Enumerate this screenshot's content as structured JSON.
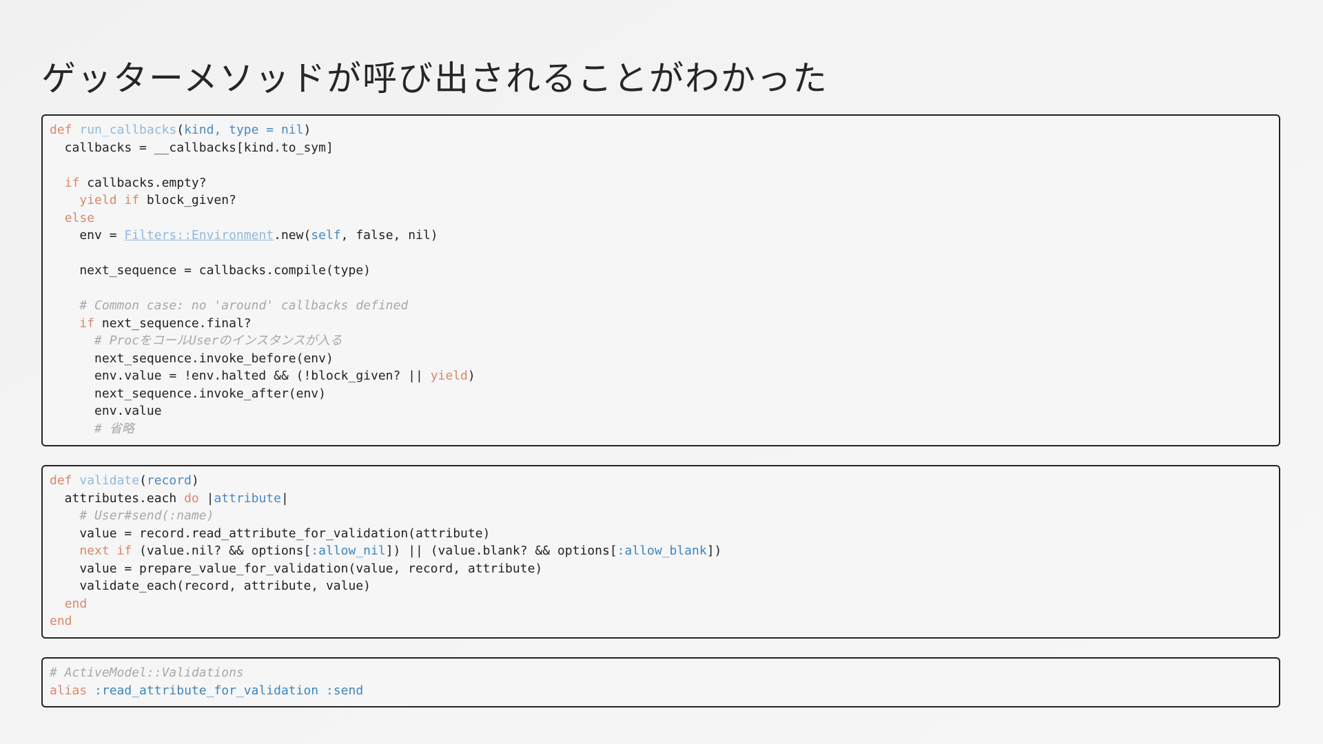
{
  "slide": {
    "title": "ゲッターメソッドが呼び出されることがわかった"
  },
  "colors": {
    "keyword": "#d9876a",
    "function_name": "#8fb9de",
    "parameter": "#4a88c0",
    "symbol": "#3b86bf",
    "comment": "#a8a8a8",
    "text": "#222222"
  },
  "code_blocks": [
    {
      "name": "code-block-run-callbacks",
      "lines": [
        [
          [
            "kw",
            "def"
          ],
          [
            "txt",
            " "
          ],
          [
            "fn",
            "run_callbacks"
          ],
          [
            "txt",
            "("
          ],
          [
            "param",
            "kind, type = nil"
          ],
          [
            "txt",
            ")"
          ]
        ],
        [
          [
            "txt",
            "  callbacks = __callbacks[kind.to_sym]"
          ]
        ],
        [],
        [
          [
            "txt",
            "  "
          ],
          [
            "kw",
            "if"
          ],
          [
            "txt",
            " callbacks.empty?"
          ]
        ],
        [
          [
            "txt",
            "    "
          ],
          [
            "kw",
            "yield if"
          ],
          [
            "txt",
            " block_given?"
          ]
        ],
        [
          [
            "txt",
            "  "
          ],
          [
            "kw",
            "else"
          ]
        ],
        [
          [
            "txt",
            "    env = "
          ],
          [
            "link",
            "Filters::Environment"
          ],
          [
            "txt",
            ".new("
          ],
          [
            "const",
            "self"
          ],
          [
            "txt",
            ", false, nil)"
          ]
        ],
        [],
        [
          [
            "txt",
            "    next_sequence = callbacks.compile(type)"
          ]
        ],
        [],
        [
          [
            "txt",
            "    "
          ],
          [
            "cm",
            "# Common case: no 'around' callbacks defined"
          ]
        ],
        [
          [
            "txt",
            "    "
          ],
          [
            "kw",
            "if"
          ],
          [
            "txt",
            " next_sequence.final?"
          ]
        ],
        [
          [
            "txt",
            "      "
          ],
          [
            "cm",
            "# ProcをコールUserのインスタンスが入る"
          ]
        ],
        [
          [
            "txt",
            "      next_sequence.invoke_before(env)"
          ]
        ],
        [
          [
            "txt",
            "      env.value = !env.halted && (!block_given? || "
          ],
          [
            "kw",
            "yield"
          ],
          [
            "txt",
            ")"
          ]
        ],
        [
          [
            "txt",
            "      next_sequence.invoke_after(env)"
          ]
        ],
        [
          [
            "txt",
            "      env.value"
          ]
        ],
        [
          [
            "txt",
            "      "
          ],
          [
            "cm",
            "# 省略"
          ]
        ]
      ]
    },
    {
      "name": "code-block-validate",
      "lines": [
        [
          [
            "kw",
            "def"
          ],
          [
            "txt",
            " "
          ],
          [
            "fn",
            "validate"
          ],
          [
            "txt",
            "("
          ],
          [
            "param",
            "record"
          ],
          [
            "txt",
            ")"
          ]
        ],
        [
          [
            "txt",
            "  attributes.each "
          ],
          [
            "kw",
            "do"
          ],
          [
            "txt",
            " |"
          ],
          [
            "param",
            "attribute"
          ],
          [
            "txt",
            "|"
          ]
        ],
        [
          [
            "txt",
            "    "
          ],
          [
            "cm",
            "# User#send(:name)"
          ]
        ],
        [
          [
            "txt",
            "    value = record.read_attribute_for_validation(attribute)"
          ]
        ],
        [
          [
            "txt",
            "    "
          ],
          [
            "kw",
            "next if"
          ],
          [
            "txt",
            " (value.nil? && options["
          ],
          [
            "sym",
            ":allow_nil"
          ],
          [
            "txt",
            "]) || (value.blank? && options["
          ],
          [
            "sym",
            ":allow_blank"
          ],
          [
            "txt",
            "])"
          ]
        ],
        [
          [
            "txt",
            "    value = prepare_value_for_validation(value, record, attribute)"
          ]
        ],
        [
          [
            "txt",
            "    validate_each(record, attribute, value)"
          ]
        ],
        [
          [
            "txt",
            "  "
          ],
          [
            "kw",
            "end"
          ]
        ],
        [
          [
            "kw",
            "end"
          ]
        ]
      ]
    },
    {
      "name": "code-block-alias",
      "lines": [
        [
          [
            "cm",
            "# ActiveModel::Validations"
          ]
        ],
        [
          [
            "kw",
            "alias"
          ],
          [
            "txt",
            " "
          ],
          [
            "sym",
            ":read_attribute_for_validation :send"
          ]
        ]
      ]
    }
  ]
}
